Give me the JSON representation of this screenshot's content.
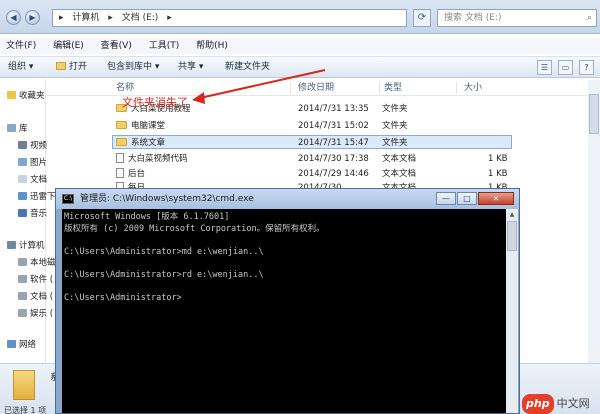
{
  "explorer": {
    "breadcrumb": [
      "计算机",
      "文档 (E:)"
    ],
    "search_placeholder": "搜索 文档 (E:)",
    "menu": [
      "文件(F)",
      "编辑(E)",
      "查看(V)",
      "工具(T)",
      "帮助(H)"
    ],
    "toolbar": {
      "organize": "组织 ▾",
      "open": "打开",
      "include_library": "包含到库中 ▾",
      "share": "共享 ▾",
      "new_folder": "新建文件夹"
    },
    "sidebar": [
      "收藏夹",
      "库",
      "视频",
      "图片",
      "文档",
      "迅雷下",
      "音乐",
      "计算机",
      "本地磁",
      "软件 (",
      "文档 (",
      "娱乐 (",
      "网络"
    ],
    "columns": {
      "name": "名称",
      "date": "修改日期",
      "type": "类型",
      "size": "大小"
    },
    "rows": [
      {
        "name": "大白菜使用教程",
        "date": "2014/7/31 13:35",
        "type": "文件夹",
        "size": ""
      },
      {
        "name": "电脑课堂",
        "date": "2014/7/31 15:02",
        "type": "文件夹",
        "size": ""
      },
      {
        "name": "系统文章",
        "date": "2014/7/31 15:47",
        "type": "文件夹",
        "size": ""
      },
      {
        "name": "大白菜视频代码",
        "date": "2014/7/30 17:38",
        "type": "文本文档",
        "size": "1 KB"
      },
      {
        "name": "后台",
        "date": "2014/7/29 14:46",
        "type": "文本文档",
        "size": "1 KB"
      },
      {
        "name": "每日",
        "date": "2014/7/30 ...",
        "type": "文本文档",
        "size": "1 KB"
      }
    ],
    "annotation": "文件夹消失了",
    "status_name": "系",
    "status_count": "已选择 1 项"
  },
  "cmd": {
    "title": "管理员: C:\\Windows\\system32\\cmd.exe",
    "icon_text": "C:\\",
    "lines": [
      "Microsoft Windows [版本 6.1.7601]",
      "版权所有 (c) 2009 Microsoft Corporation。保留所有权利。",
      "",
      "C:\\Users\\Administrator>md e:\\wenjian..\\",
      "",
      "C:\\Users\\Administrator>rd e:\\wenjian..\\",
      "",
      "C:\\Users\\Administrator>"
    ]
  },
  "watermark": {
    "logo": "php",
    "text": "中文网"
  }
}
